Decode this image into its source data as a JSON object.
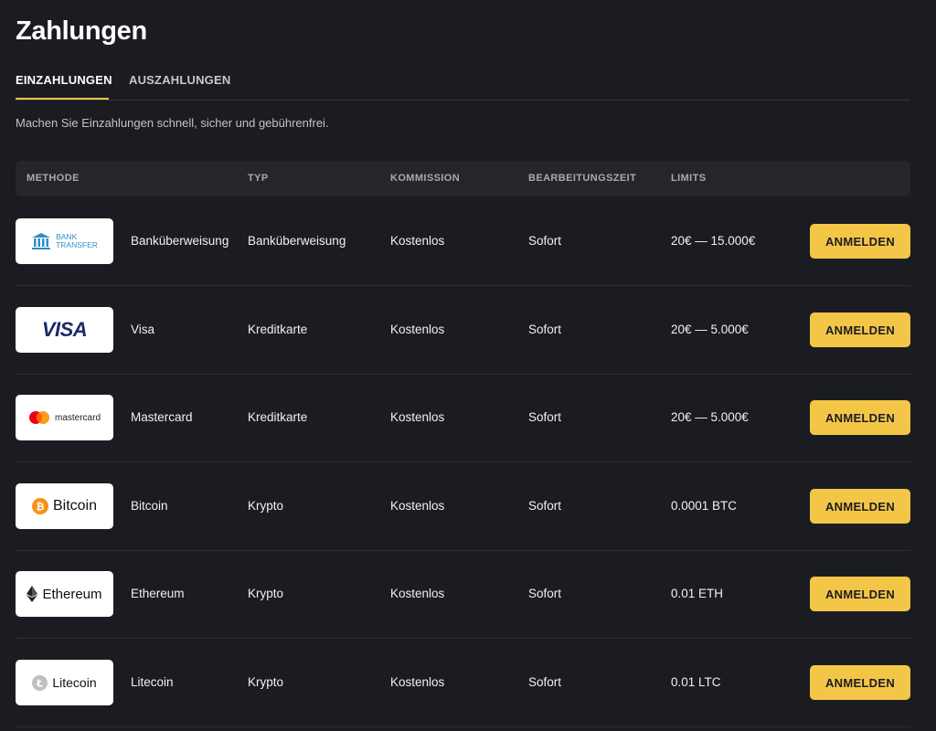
{
  "page": {
    "title": "Zahlungen",
    "intro": "Machen Sie Einzahlungen schnell, sicher und gebührenfrei."
  },
  "tabs": [
    {
      "label": "EINZAHLUNGEN",
      "active": true
    },
    {
      "label": "AUSZAHLUNGEN",
      "active": false
    }
  ],
  "table": {
    "headers": {
      "method": "METHODE",
      "type": "TYP",
      "commission": "KOMMISSION",
      "time": "BEARBEITUNGSZEIT",
      "limits": "LIMITS"
    },
    "rows": [
      {
        "logo_icon": "bank-icon",
        "logo_line1": "BANK",
        "logo_line2": "TRANSFER",
        "method": "Banküberweisung",
        "type": "Banküberweisung",
        "commission": "Kostenlos",
        "time": "Sofort",
        "limits": "20€ — 15.000€",
        "button": "ANMELDEN"
      },
      {
        "logo_icon": "visa-icon",
        "logo_text": "VISA",
        "method": "Visa",
        "type": "Kreditkarte",
        "commission": "Kostenlos",
        "time": "Sofort",
        "limits": "20€ — 5.000€",
        "button": "ANMELDEN"
      },
      {
        "logo_icon": "mastercard-icon",
        "logo_text": "mastercard",
        "method": "Mastercard",
        "type": "Kreditkarte",
        "commission": "Kostenlos",
        "time": "Sofort",
        "limits": "20€ — 5.000€",
        "button": "ANMELDEN"
      },
      {
        "logo_icon": "bitcoin-icon",
        "logo_text": "Bitcoin",
        "method": "Bitcoin",
        "type": "Krypto",
        "commission": "Kostenlos",
        "time": "Sofort",
        "limits": "0.0001 BTC",
        "button": "ANMELDEN"
      },
      {
        "logo_icon": "ethereum-icon",
        "logo_text": "Ethereum",
        "method": "Ethereum",
        "type": "Krypto",
        "commission": "Kostenlos",
        "time": "Sofort",
        "limits": "0.01 ETH",
        "button": "ANMELDEN"
      },
      {
        "logo_icon": "litecoin-icon",
        "logo_text": "Litecoin",
        "method": "Litecoin",
        "type": "Krypto",
        "commission": "Kostenlos",
        "time": "Sofort",
        "limits": "0.01 LTC",
        "button": "ANMELDEN"
      }
    ]
  },
  "colors": {
    "accent": "#f4c647",
    "background": "#1b1c21",
    "header_bg": "#25262c",
    "bitcoin": "#f7931a",
    "bank": "#2d8fc2",
    "visa": "#1a2a6c"
  }
}
